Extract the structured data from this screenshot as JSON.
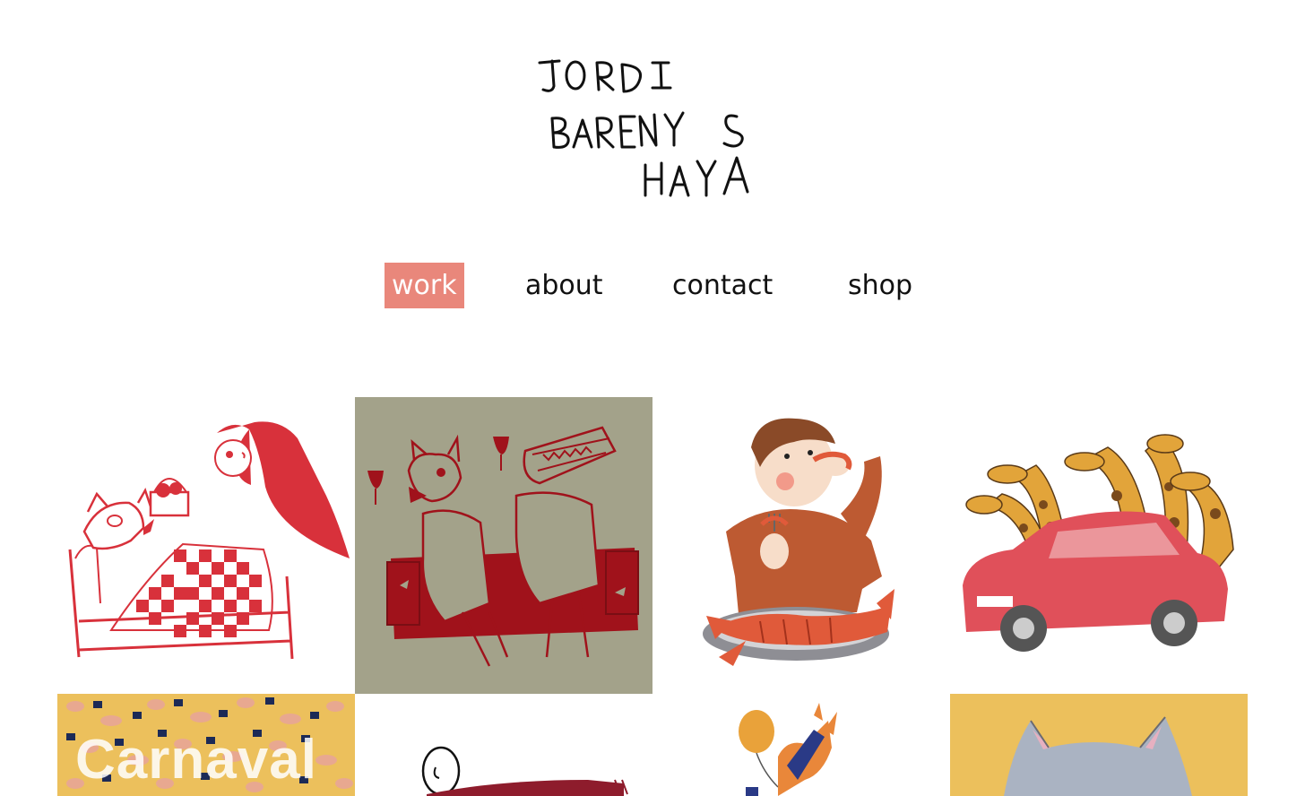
{
  "site": {
    "logo_lines": [
      "JORDI",
      "BARENYS",
      "HAYA"
    ]
  },
  "nav": {
    "items": [
      {
        "label": "work",
        "active": true
      },
      {
        "label": "about",
        "active": false
      },
      {
        "label": "contact",
        "active": false
      },
      {
        "label": "shop",
        "active": false
      }
    ]
  },
  "gallery": {
    "tiles": [
      {
        "subject": "red-riding-hood-wolf-in-bed",
        "caption": ""
      },
      {
        "subject": "wolf-and-crocodile-on-sofa",
        "caption": ""
      },
      {
        "subject": "boy-eating-shrimp",
        "caption": ""
      },
      {
        "subject": "giraffes-in-red-car",
        "caption": ""
      },
      {
        "subject": "carnival-crowd-pattern",
        "caption": "Carnaval"
      },
      {
        "subject": "man-with-scarf",
        "caption": ""
      },
      {
        "subject": "balloon-figure",
        "caption": ""
      },
      {
        "subject": "grey-cat",
        "caption": ""
      }
    ]
  },
  "colors": {
    "accent": "#e9877b",
    "illustration_red": "#d8313b",
    "olive_bg": "#a3a28a",
    "dark_red": "#a0121b",
    "rust": "#bd5a32",
    "mustard_bg": "#ecc05c"
  }
}
